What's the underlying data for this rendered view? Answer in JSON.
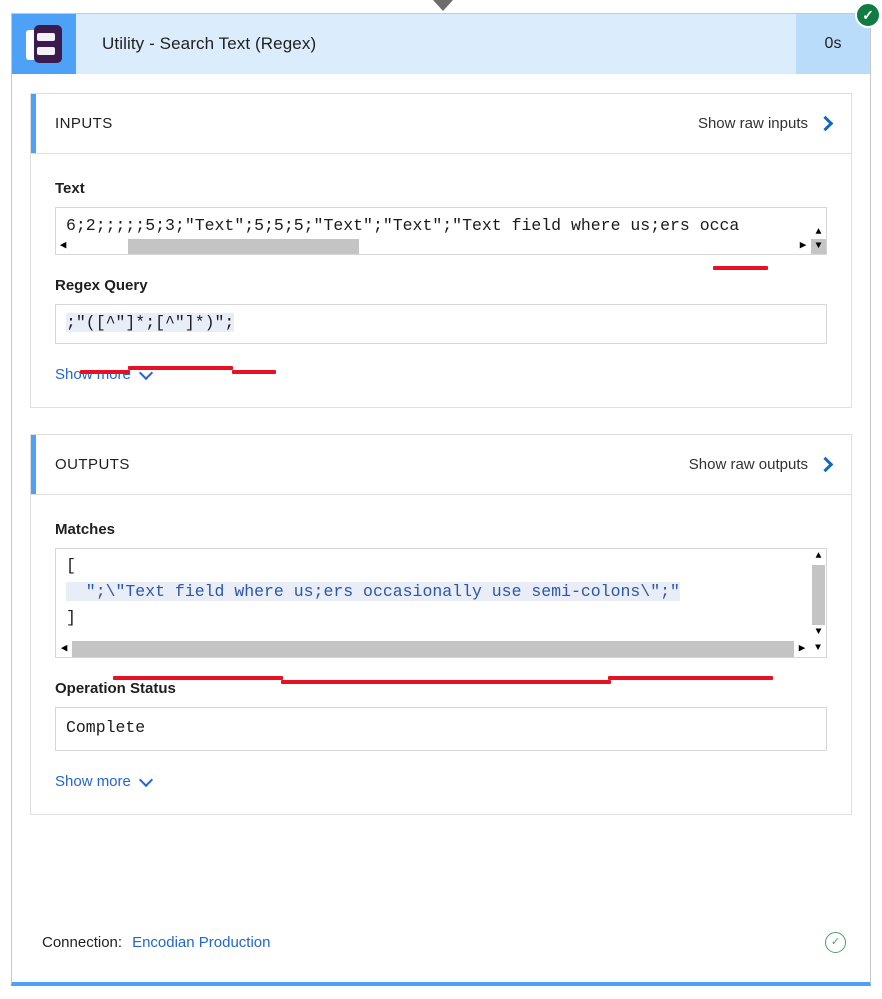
{
  "header": {
    "title": "Utility - Search Text (Regex)",
    "duration": "0s",
    "status_icon": "check-circle-icon",
    "status_glyph": "✓",
    "logo_name": "encodian-logo"
  },
  "inputs": {
    "section_title": "INPUTS",
    "raw_link_label": "Show raw inputs",
    "fields": [
      {
        "label": "Text",
        "value": "6;2;;;;;5;3;\"Text\";5;5;5;\"Text\";\"Text\";\"Text field where us;ers occa"
      },
      {
        "label": "Regex Query",
        "value": ";\"([^\"]*;[^\"]*)\";"
      }
    ],
    "show_more_label": "Show more"
  },
  "outputs": {
    "section_title": "OUTPUTS",
    "raw_link_label": "Show raw outputs",
    "matches_label": "Matches",
    "matches_lines": [
      "[",
      "  \";\\\"Text field where us;ers occasionally use semi-colons\\\";\"",
      "]"
    ],
    "status_label": "Operation Status",
    "status_value": "Complete",
    "show_more_label": "Show more"
  },
  "footer": {
    "connection_label": "Connection:",
    "connection_value": "Encodian Production",
    "check_icon": "check-circle-outline-icon",
    "check_glyph": "✓"
  },
  "colors": {
    "accent_blue": "#4da2f7",
    "header_bg": "#dbedfc",
    "duration_bg": "#b9dcfb",
    "link_blue": "#2266d6",
    "success_green": "#107c41",
    "annotation_red": "#e81123",
    "logo_purple": "#3b1b4d"
  }
}
